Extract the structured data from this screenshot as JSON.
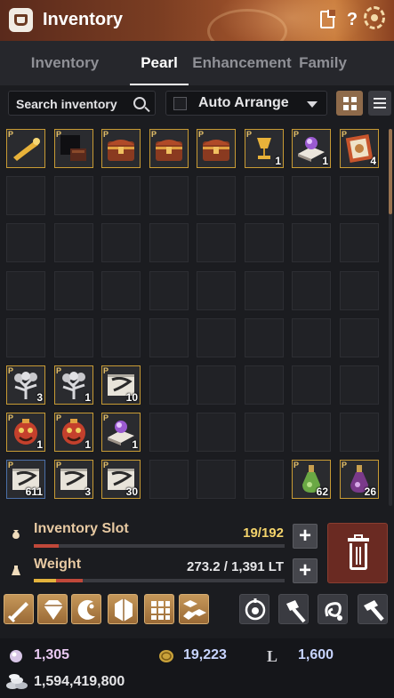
{
  "header": {
    "title": "Inventory",
    "help": "?"
  },
  "tabs": [
    {
      "label": "Inventory",
      "active": false
    },
    {
      "label": "Pearl",
      "active": true
    },
    {
      "label": "Enhancement",
      "active": false
    },
    {
      "label": "Family",
      "active": false
    }
  ],
  "toolbar": {
    "search_placeholder": "Search inventory",
    "auto_arrange_label": "Auto Arrange",
    "auto_arrange_checked": false,
    "view_mode": "grid"
  },
  "grid": {
    "columns": 8,
    "rows": 8
  },
  "items": [
    {
      "row": 0,
      "col": 0,
      "icon": "golden-horn-icon",
      "pearl": "P",
      "count": ""
    },
    {
      "row": 0,
      "col": 1,
      "icon": "dark-costume-box-icon",
      "pearl": "P",
      "count": ""
    },
    {
      "row": 0,
      "col": 2,
      "icon": "treasure-chest-icon",
      "pearl": "P",
      "count": ""
    },
    {
      "row": 0,
      "col": 3,
      "icon": "treasure-chest-icon",
      "pearl": "P",
      "count": ""
    },
    {
      "row": 0,
      "col": 4,
      "icon": "treasure-chest-icon",
      "pearl": "P",
      "count": ""
    },
    {
      "row": 0,
      "col": 5,
      "icon": "golden-goblet-icon",
      "pearl": "P",
      "count": "1"
    },
    {
      "row": 0,
      "col": 6,
      "icon": "crystal-book-icon",
      "pearl": "P",
      "count": "1"
    },
    {
      "row": 0,
      "col": 7,
      "icon": "scroll-icon",
      "pearl": "P",
      "count": "4"
    },
    {
      "row": 5,
      "col": 0,
      "icon": "silver-tree-icon",
      "pearl": "P",
      "count": "3"
    },
    {
      "row": 5,
      "col": 1,
      "icon": "silver-tree-icon",
      "pearl": "P",
      "count": "1"
    },
    {
      "row": 5,
      "col": 2,
      "icon": "map-scroll-icon",
      "pearl": "P",
      "count": "10"
    },
    {
      "row": 6,
      "col": 0,
      "icon": "red-lantern-mask-icon",
      "pearl": "P",
      "count": "1"
    },
    {
      "row": 6,
      "col": 1,
      "icon": "red-lantern-mask-icon",
      "pearl": "P",
      "count": "1"
    },
    {
      "row": 6,
      "col": 2,
      "icon": "crystal-book-icon",
      "pearl": "P",
      "count": "1"
    },
    {
      "row": 7,
      "col": 0,
      "icon": "map-scroll-icon",
      "pearl": "P",
      "count": "611",
      "blue": true
    },
    {
      "row": 7,
      "col": 1,
      "icon": "map-scroll-icon",
      "pearl": "P",
      "count": "3"
    },
    {
      "row": 7,
      "col": 2,
      "icon": "map-scroll-icon",
      "pearl": "P",
      "count": "30"
    },
    {
      "row": 7,
      "col": 6,
      "icon": "green-potion-icon",
      "pearl": "P",
      "count": "62"
    },
    {
      "row": 7,
      "col": 7,
      "icon": "purple-potion-icon",
      "pearl": "P",
      "count": "26"
    }
  ],
  "status": {
    "slot_label": "Inventory Slot",
    "slot_value": "19/192",
    "slot_fraction": 0.099,
    "weight_label": "Weight",
    "weight_value": "273.2 / 1,391 LT",
    "weight_fraction": 0.196,
    "plus": "+"
  },
  "actions": [
    {
      "name": "enhance-sword-icon",
      "style": "gold"
    },
    {
      "name": "gem-crystal-icon",
      "style": "gold"
    },
    {
      "name": "moon-swirl-icon",
      "style": "gold"
    },
    {
      "name": "hexagon-crystal-icon",
      "style": "gold"
    },
    {
      "name": "grid-pattern-icon",
      "style": "gold"
    },
    {
      "name": "cube-craft-icon",
      "style": "gold"
    },
    {
      "name": "target-lock-icon",
      "style": "gray"
    },
    {
      "name": "hammer-icon",
      "style": "gray"
    },
    {
      "name": "swirl-icon",
      "style": "gray"
    },
    {
      "name": "forge-hammer-icon",
      "style": "gray"
    }
  ],
  "currency": {
    "pearls": "1,305",
    "loyalty": "19,223",
    "l_symbol": "L",
    "l_value": "1,600",
    "silver": "1,594,419,800"
  },
  "colors": {
    "gold_border": "#c89b34",
    "accent_brown": "#8e6a4a",
    "pearl_text": "#e9c9f2",
    "slot_text": "#f3d36b"
  }
}
